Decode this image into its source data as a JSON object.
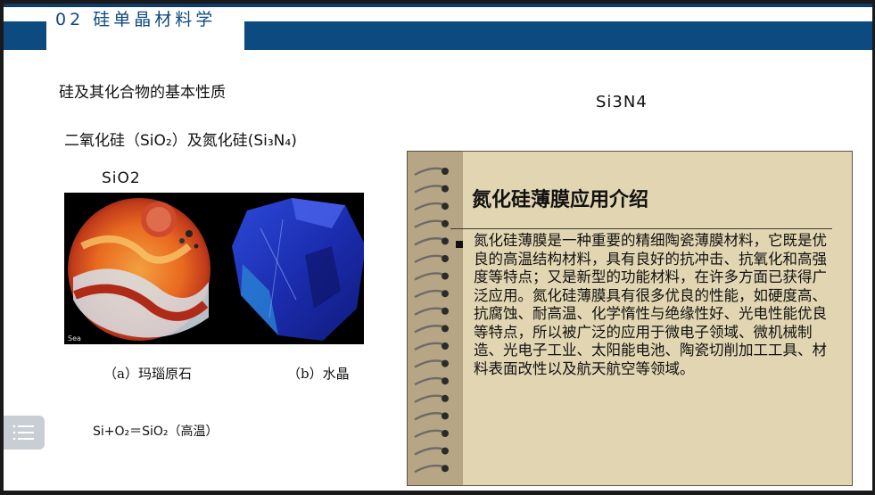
{
  "header": {
    "title": "02 硅单晶材料学"
  },
  "content": {
    "heading": "硅及其化合物的基本性质",
    "compounds": "二氧化硅（SiO₂）及氮化硅(Si₃N₄)",
    "sio2_label": "SiO2",
    "si3n4_label": "Si3N4",
    "caption_a": "（a）玛瑙原石",
    "caption_b": "（b）水晶",
    "equation": "Si+O₂＝SiO₂（高温）"
  },
  "notebook": {
    "title": "氮化硅薄膜应用介绍",
    "body": "氮化硅薄膜是一种重要的精细陶瓷薄膜材料，它既是优良的高温结构材料，具有良好的抗冲击、抗氧化和高强度等特点；又是新型的功能材料，在许多方面已获得广泛应用。氮化硅薄膜具有很多优良的性能，如硬度高、抗腐蚀、耐高温、化学惰性与绝缘性好、光电性能优良等特点，所以被广泛的应用于微电子领域、微机械制造、光电子工业、太阳能电池、陶瓷切削加工工具、材料表面改性以及航天航空等领域。"
  },
  "photo": {
    "watermark": "Sea"
  },
  "colors": {
    "brand": "#0d4a80",
    "notebook_bg": "#e2d6b2"
  },
  "icons": {
    "menu": "list-menu-icon"
  }
}
